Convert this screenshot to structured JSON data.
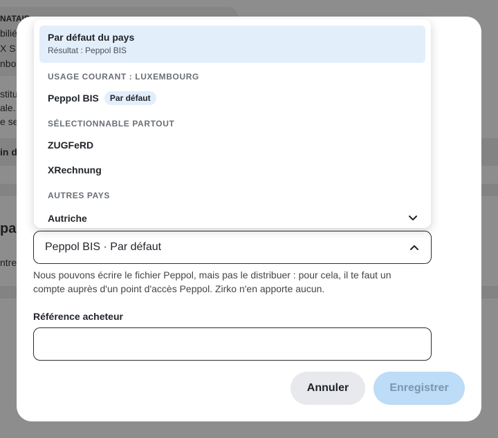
{
  "background": {
    "lines": [
      "NATAIR",
      "bilié",
      "X S",
      "nbou",
      "stitu",
      "ale. -",
      "e sec",
      "in de",
      "pai",
      "ntrep"
    ]
  },
  "modal": {
    "select": {
      "value": "Peppol BIS · Par défaut",
      "icon": "chevron-up-icon"
    },
    "hint": "Nous pouvons écrire le fichier Peppol, mais pas le distribuer : pour cela, il te faut un compte auprès d'un point d'accès Peppol. Zirko n'en apporte aucun.",
    "buyer_ref": {
      "label": "Référence acheteur",
      "value": "",
      "placeholder": ""
    },
    "buttons": {
      "cancel": "Annuler",
      "save": "Enregistrer"
    },
    "colors": {
      "save_bg": "#bcdcf7",
      "selected_bg": "#e3eefb"
    }
  },
  "dropdown": {
    "selected": {
      "title": "Par défaut du pays",
      "subtitle": "Résultat : Peppol BIS"
    },
    "groups": [
      {
        "header": "USAGE COURANT : LUXEMBOURG",
        "items": [
          {
            "label": "Peppol BIS",
            "badge": "Par défaut"
          }
        ]
      },
      {
        "header": "SÉLECTIONNABLE PARTOUT",
        "items": [
          {
            "label": "ZUGFeRD"
          },
          {
            "label": "XRechnung"
          }
        ]
      },
      {
        "header": "AUTRES PAYS",
        "items": [
          {
            "label": "Autriche",
            "icon": "chevron-down-icon"
          }
        ]
      }
    ]
  }
}
